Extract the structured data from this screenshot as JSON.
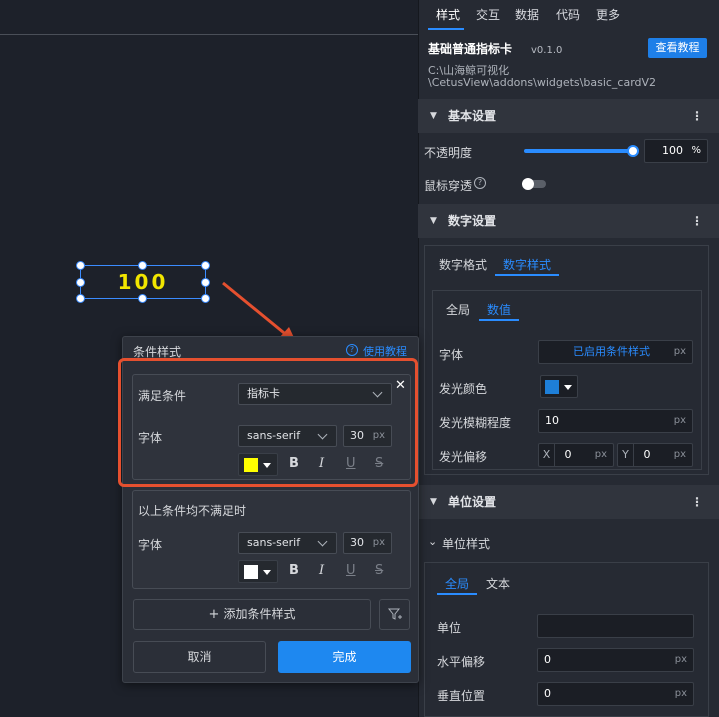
{
  "canvas": {
    "widget_value": "100"
  },
  "tabs": [
    {
      "label": "样式"
    },
    {
      "label": "交互"
    },
    {
      "label": "数据"
    },
    {
      "label": "代码"
    },
    {
      "label": "更多"
    }
  ],
  "widget": {
    "title": "基础普通指标卡",
    "version": "v0.1.0",
    "help_button": "查看教程",
    "path_line1": "C:\\山海鲸可视化",
    "path_line2": "\\CetusView\\addons\\widgets\\basic_cardV2"
  },
  "basic_settings": {
    "title": "基本设置",
    "opacity_label": "不透明度",
    "opacity_value": "100",
    "opacity_unit": "%",
    "opacity_level": 1.0,
    "passthrough_label": "鼠标穿透",
    "passthrough_on": false
  },
  "number_settings": {
    "title": "数字设置",
    "tabs": [
      {
        "label": "数字格式"
      },
      {
        "label": "数字样式"
      }
    ],
    "subtabs": [
      {
        "label": "全局"
      },
      {
        "label": "数值"
      }
    ],
    "font_label": "字体",
    "font_value": "已启用条件样式",
    "font_unit": "px",
    "glow_color_label": "发光颜色",
    "glow_color": "#1e7fd8",
    "glow_blur_label": "发光模糊程度",
    "glow_blur_value": "10",
    "glow_blur_unit": "px",
    "glow_offset_label": "发光偏移",
    "offset_x_label": "X",
    "offset_x_value": "0",
    "offset_y_label": "Y",
    "offset_y_value": "0",
    "offset_unit": "px"
  },
  "unit_settings": {
    "title": "单位设置",
    "sub_title": "单位样式",
    "tabs": [
      {
        "label": "全局"
      },
      {
        "label": "文本"
      }
    ],
    "unit_label": "单位",
    "unit_value": "",
    "h_offset_label": "水平偏移",
    "h_offset_value": "0",
    "h_offset_unit": "px",
    "v_pos_label": "垂直位置",
    "v_pos_value": "0",
    "v_pos_unit": "px"
  },
  "popup": {
    "title": "条件样式",
    "help": "使用教程",
    "condition1": {
      "cond_label": "满足条件",
      "cond_value": "指标卡",
      "font_label": "字体",
      "font_family": "sans-serif",
      "font_size": "30",
      "font_unit": "px",
      "color": "#ffff00",
      "bold": "B",
      "italic": "I",
      "underline": "U",
      "strike": "S"
    },
    "condition2": {
      "title": "以上条件均不满足时",
      "font_label": "字体",
      "font_family": "sans-serif",
      "font_size": "30",
      "font_unit": "px",
      "color": "#ffffff",
      "bold": "B",
      "italic": "I",
      "underline": "U",
      "strike": "S"
    },
    "add_button": "添加条件样式",
    "cancel_button": "取消",
    "done_button": "完成"
  },
  "colors": {
    "accent": "#2a8cff",
    "highlight": "#e5502f"
  }
}
